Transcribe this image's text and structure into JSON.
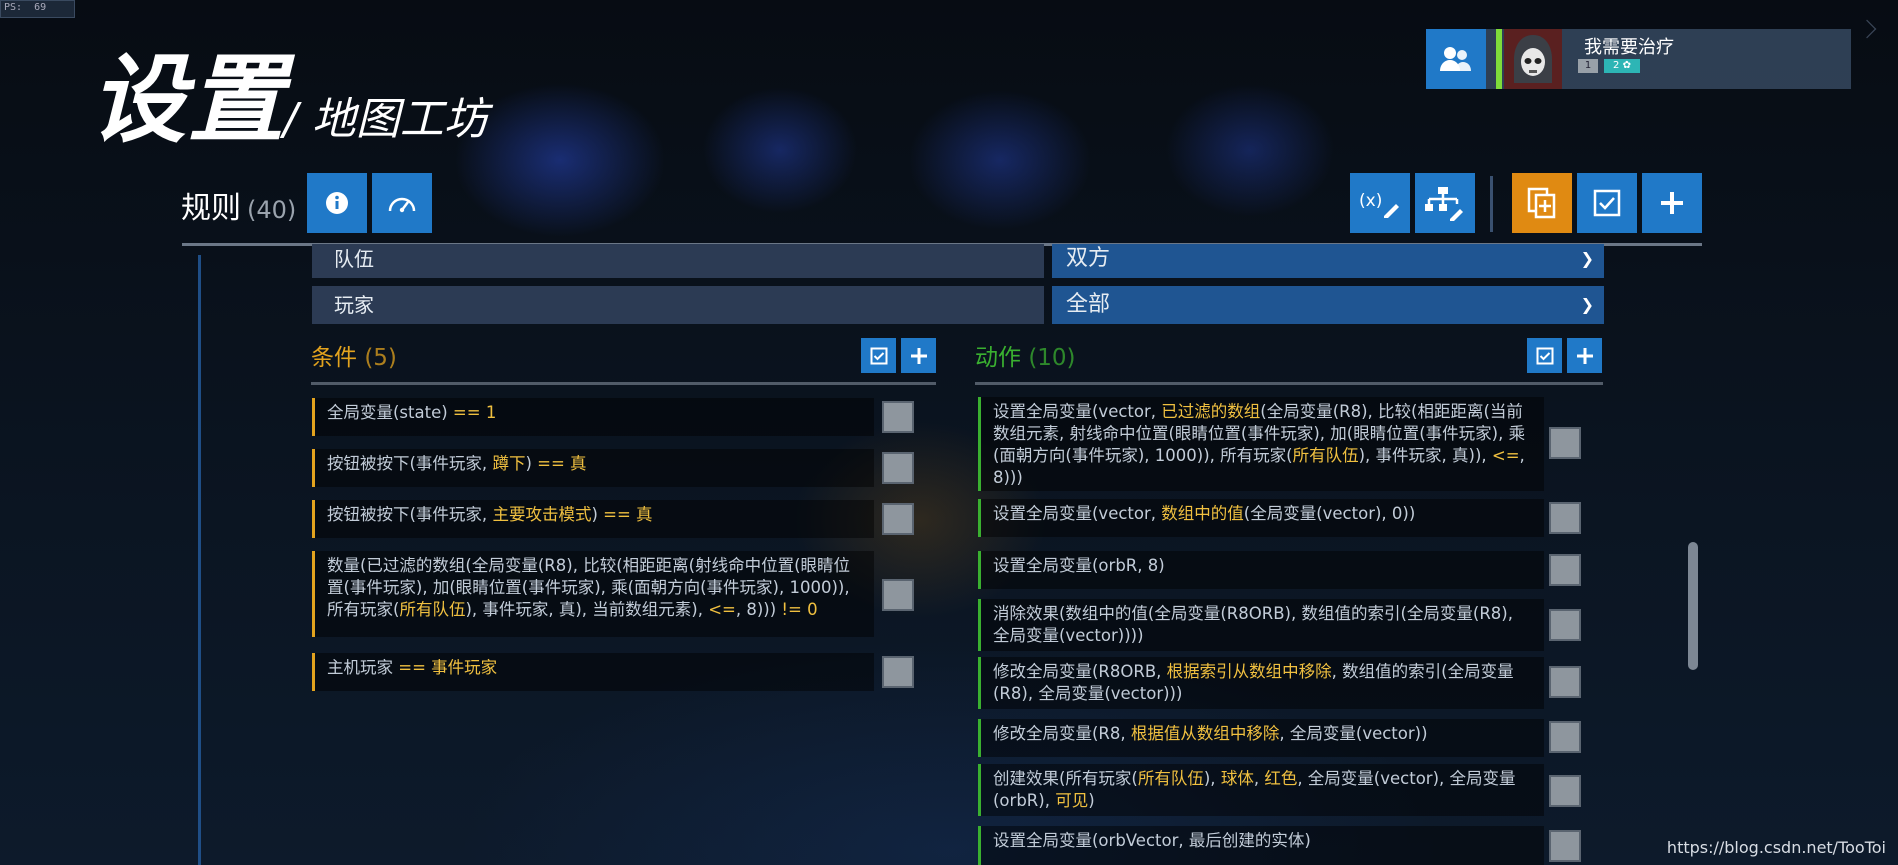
{
  "fps": "PS:  69",
  "title": {
    "main": "设置",
    "sub": "/ 地图工坊"
  },
  "profile": {
    "name": "我需要治疗",
    "level1": "1",
    "level2": "2 ✿"
  },
  "rules": {
    "label": "规则",
    "count": "(40)"
  },
  "fields": [
    {
      "key": "队伍",
      "value": "双方"
    },
    {
      "key": "玩家",
      "value": "全部"
    }
  ],
  "conditions": {
    "title": "条件",
    "count": "(5)",
    "items": [
      {
        "segs": [
          [
            "全局变量(state) ",
            "n"
          ],
          [
            "== 1",
            "y"
          ]
        ]
      },
      {
        "segs": [
          [
            "按钮被按下(事件玩家, ",
            "n"
          ],
          [
            "蹲下",
            "y"
          ],
          [
            ") ",
            "n"
          ],
          [
            "== 真",
            "y"
          ]
        ]
      },
      {
        "segs": [
          [
            "按钮被按下(事件玩家, ",
            "n"
          ],
          [
            "主要攻击模式",
            "y"
          ],
          [
            ") ",
            "n"
          ],
          [
            "== 真",
            "y"
          ]
        ]
      },
      {
        "segs": [
          [
            "数量(已过滤的数组(全局变量(R8), 比较(相距距离(射线命中位置(眼睛位置(事件玩家), 加(眼睛位置(事件玩家), 乘(面朝方向(事件玩家), 1000)), 所有玩家(",
            "n"
          ],
          [
            "所有队伍",
            "y"
          ],
          [
            "), 事件玩家, 真), 当前数组元素), ",
            "n"
          ],
          [
            "<=",
            "y"
          ],
          [
            ", 8))) ",
            "n"
          ],
          [
            "!= 0",
            "y"
          ]
        ]
      },
      {
        "segs": [
          [
            "主机玩家 ",
            "n"
          ],
          [
            "== 事件玩家",
            "y"
          ]
        ]
      }
    ]
  },
  "actions": {
    "title": "动作",
    "count": "(10)",
    "items": [
      {
        "segs": [
          [
            "设置全局变量(vector, ",
            "n"
          ],
          [
            "已过滤的数组",
            "y"
          ],
          [
            "(全局变量(R8), 比较(相距距离(当前数组元素, 射线命中位置(眼睛位置(事件玩家), 加(眼睛位置(事件玩家), 乘(面朝方向(事件玩家), 1000)), 所有玩家(",
            "n"
          ],
          [
            "所有队伍",
            "y"
          ],
          [
            "), 事件玩家, 真)), ",
            "n"
          ],
          [
            "<=",
            "y"
          ],
          [
            ", 8)))",
            "n"
          ]
        ]
      },
      {
        "segs": [
          [
            "设置全局变量(vector, ",
            "n"
          ],
          [
            "数组中的值",
            "y"
          ],
          [
            "(全局变量(vector), 0))",
            "n"
          ]
        ]
      },
      {
        "segs": [
          [
            "设置全局变量(orbR, 8)",
            "n"
          ]
        ]
      },
      {
        "segs": [
          [
            "消除效果(数组中的值(全局变量(R8ORB), 数组值的索引(全局变量(R8), 全局变量(vector))))",
            "n"
          ]
        ]
      },
      {
        "segs": [
          [
            "修改全局变量(R8ORB, ",
            "n"
          ],
          [
            "根据索引从数组中移除",
            "y"
          ],
          [
            ", 数组值的索引(全局变量(R8), 全局变量(vector)))",
            "n"
          ]
        ]
      },
      {
        "segs": [
          [
            "修改全局变量(R8, ",
            "n"
          ],
          [
            "根据值从数组中移除",
            "y"
          ],
          [
            ", 全局变量(vector))",
            "n"
          ]
        ]
      },
      {
        "segs": [
          [
            "创建效果(所有玩家(",
            "n"
          ],
          [
            "所有队伍",
            "y"
          ],
          [
            "), ",
            "n"
          ],
          [
            "球体",
            "y"
          ],
          [
            ", ",
            "n"
          ],
          [
            "红色",
            "y"
          ],
          [
            ", 全局变量(vector), 全局变量(orbR), ",
            "n"
          ],
          [
            "可见",
            "y"
          ],
          [
            ")",
            "n"
          ]
        ]
      },
      {
        "segs": [
          [
            "设置全局变量(orbVector, 最后创建的实体)",
            "n"
          ]
        ]
      }
    ]
  },
  "watermark": "https://blog.csdn.net/TooToi",
  "colors": {
    "accent": "#2079c8",
    "orange": "#e08a12",
    "condition": "#e3a31e",
    "action": "#3ab030",
    "keyword": "#f0c040"
  }
}
